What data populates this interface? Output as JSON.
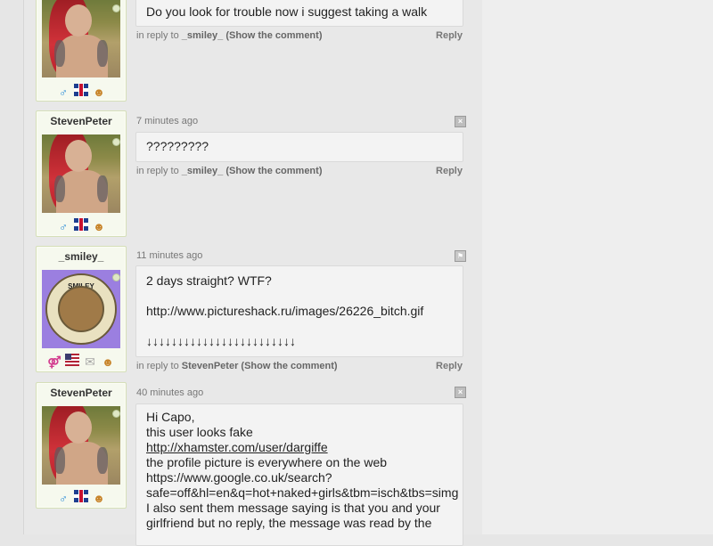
{
  "comments": [
    {
      "username": "",
      "avatar": "girl",
      "time": "",
      "lines": [
        "Do you look for trouble now i suggest taking a walk"
      ],
      "reply_to_prefix": "in reply to",
      "reply_to_user": "_smiley_",
      "show_comment": "(Show the comment)",
      "reply_label": "Reply",
      "icons": [
        "male-icon",
        "uk-flag-icon",
        "webcam-face-icon"
      ]
    },
    {
      "username": "StevenPeter",
      "avatar": "girl",
      "time": "7 minutes ago",
      "lines": [
        "?????????"
      ],
      "reply_to_prefix": "in reply to",
      "reply_to_user": "_smiley_",
      "show_comment": "(Show the comment)",
      "reply_label": "Reply",
      "icons": [
        "male-icon",
        "uk-flag-icon",
        "webcam-face-icon"
      ]
    },
    {
      "username": "_smiley_",
      "avatar": "badge",
      "avatar_text": "SMILEY",
      "time": "11 minutes ago",
      "lines": [
        "2 days straight? WTF?",
        "",
        "http://www.pictureshack.ru/images/26226_bitch.gif",
        "",
        "↓↓↓↓↓↓↓↓↓↓↓↓↓↓↓↓↓↓↓↓↓↓↓↓"
      ],
      "reply_to_prefix": "in reply to",
      "reply_to_user": "StevenPeter",
      "show_comment": "(Show the comment)",
      "reply_label": "Reply",
      "icons": [
        "couple-icon",
        "us-flag-icon",
        "mail-icon",
        "webcam-face-icon"
      ]
    },
    {
      "username": "StevenPeter",
      "avatar": "girl",
      "time": "40 minutes ago",
      "lines": [
        "Hi Capo,",
        "this user looks fake",
        "http://xhamster.com/user/dargiffe",
        "the profile picture is everywhere on the web",
        "https://www.google.co.uk/search?",
        "safe=off&hl=en&q=hot+naked+girls&tbm=isch&tbs=simg",
        "I also sent them message saying is that you and your",
        "girlfriend but no reply, the message was read by the"
      ],
      "link_line_index": 2,
      "icons": [
        "male-icon",
        "uk-flag-icon",
        "webcam-face-icon"
      ]
    }
  ]
}
